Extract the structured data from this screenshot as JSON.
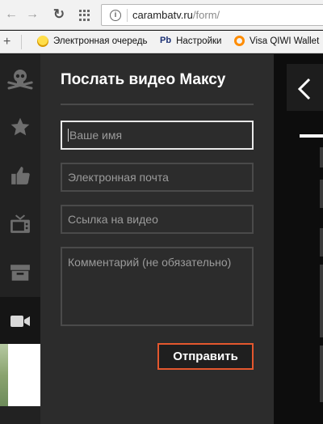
{
  "browser": {
    "url_domain": "carambatv.ru",
    "url_path": "/form/",
    "bookmarks": [
      {
        "label": "Электронная очередь",
        "icon": "yellow-circle-icon"
      },
      {
        "label": "Настройки",
        "icon_text": "Pb"
      },
      {
        "label": "Visa QIWI Wallet",
        "icon": "qiwi-icon"
      }
    ]
  },
  "sidebar": {
    "items": [
      "skull-crossbones-icon",
      "star-icon",
      "thumbs-up-icon",
      "tv-icon",
      "archive-box-icon",
      "video-camera-icon"
    ],
    "active": "video-camera-icon"
  },
  "form": {
    "title": "Послать видео Максу",
    "name_placeholder": "Ваше имя",
    "email_placeholder": "Электронная почта",
    "link_placeholder": "Ссылка на видео",
    "comment_placeholder": "Комментарий (не обязательно)",
    "submit_label": "Отправить"
  },
  "colors": {
    "panel_bg": "#2c2c2c",
    "rail_bg": "#222222",
    "field_border": "#4a4a4a",
    "submit_border": "#e4572e"
  }
}
